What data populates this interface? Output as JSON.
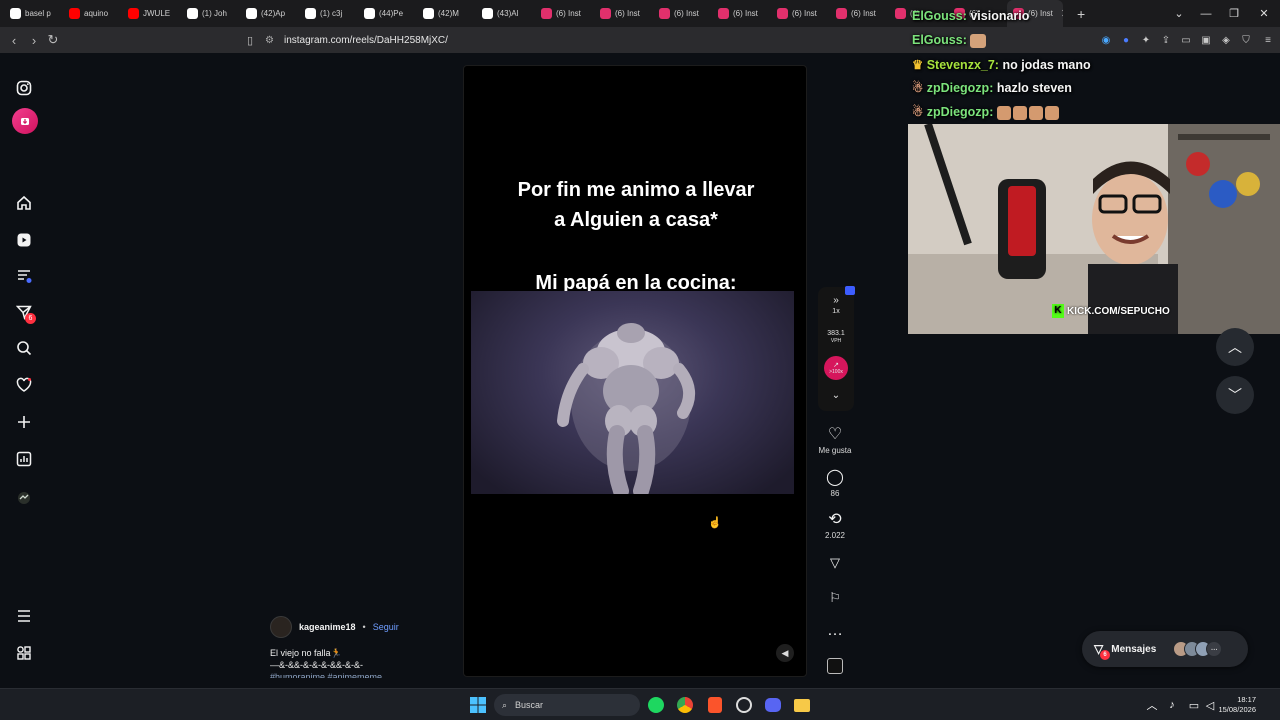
{
  "browser": {
    "tabs": [
      {
        "label": "basel p",
        "color": "#ffffff"
      },
      {
        "label": "aquino",
        "color": "#ff0000"
      },
      {
        "label": "JWULE",
        "color": "#ff0000"
      },
      {
        "label": "(1) Joh",
        "color": "#ffffff"
      },
      {
        "label": "(42)Ap",
        "color": "#ffffff"
      },
      {
        "label": "(1) c3j",
        "color": "#ffffff"
      },
      {
        "label": "(44)Pe",
        "color": "#ffffff"
      },
      {
        "label": "(42)M",
        "color": "#ffffff"
      },
      {
        "label": "(43)Al",
        "color": "#ffffff"
      },
      {
        "label": "(6) Inst",
        "color": "#e1306c"
      },
      {
        "label": "(6) Inst",
        "color": "#e1306c"
      },
      {
        "label": "(6) Inst",
        "color": "#e1306c"
      },
      {
        "label": "(6) Inst",
        "color": "#e1306c"
      },
      {
        "label": "(6) Inst",
        "color": "#e1306c"
      },
      {
        "label": "(6) Inst",
        "color": "#e1306c"
      },
      {
        "label": "(6)",
        "color": "#e1306c"
      },
      {
        "label": "(6)",
        "color": "#e1306c"
      },
      {
        "label": "(6) Inst",
        "color": "#e1306c"
      }
    ],
    "url": "instagram.com/reels/DaHH258MjXC/"
  },
  "ig_nav": {
    "items": [
      "instagram-icon",
      "download-icon",
      "home-icon",
      "reels-icon",
      "feed-icon",
      "direct-icon",
      "search-icon",
      "heart-icon",
      "create-icon",
      "stats-icon",
      "profile-icon",
      "menu-icon",
      "apps-icon"
    ],
    "direct_badge": "6"
  },
  "reel": {
    "caption_line1": "Por fin me animo a llevar",
    "caption_line2": "a Alguien a casa*",
    "caption_line3": "Mi papá en la cocina:",
    "speed": {
      "rate": "1x",
      "value": "383.1",
      "unit": "VPH",
      "boost": ">100x"
    }
  },
  "actions": {
    "like_label": "Me gusta",
    "comments_count": "86",
    "shares_count": "2.022"
  },
  "author": {
    "username": "kageanime18",
    "follow_label": "Seguir",
    "desc_line1": "El viejo no falla🏃",
    "desc_line2": "—&-&&-&-&-&-&&-&-&-",
    "desc_line3": "#humoranime #animememe"
  },
  "stream": {
    "chat": [
      {
        "user": "ElGouss:",
        "msg": "visionario",
        "color": "#7ce37c"
      },
      {
        "user": "ElGouss:",
        "msg": "",
        "color": "#7ce37c"
      },
      {
        "user": "Stevenzx_7:",
        "msg": "no jodas mano",
        "color": "#a6e23d"
      },
      {
        "user": "zpDiegozp:",
        "msg": "hazlo steven",
        "color": "#7ce37c"
      },
      {
        "user": "zpDiegozp:",
        "msg": "",
        "color": "#7ce37c"
      }
    ],
    "watermark": "KICK.COM/SEPUCHO"
  },
  "messages": {
    "label": "Mensajes",
    "badge": "6"
  },
  "taskbar": {
    "search_placeholder": "Buscar",
    "time": "18:17",
    "date": "15/08/2026"
  }
}
